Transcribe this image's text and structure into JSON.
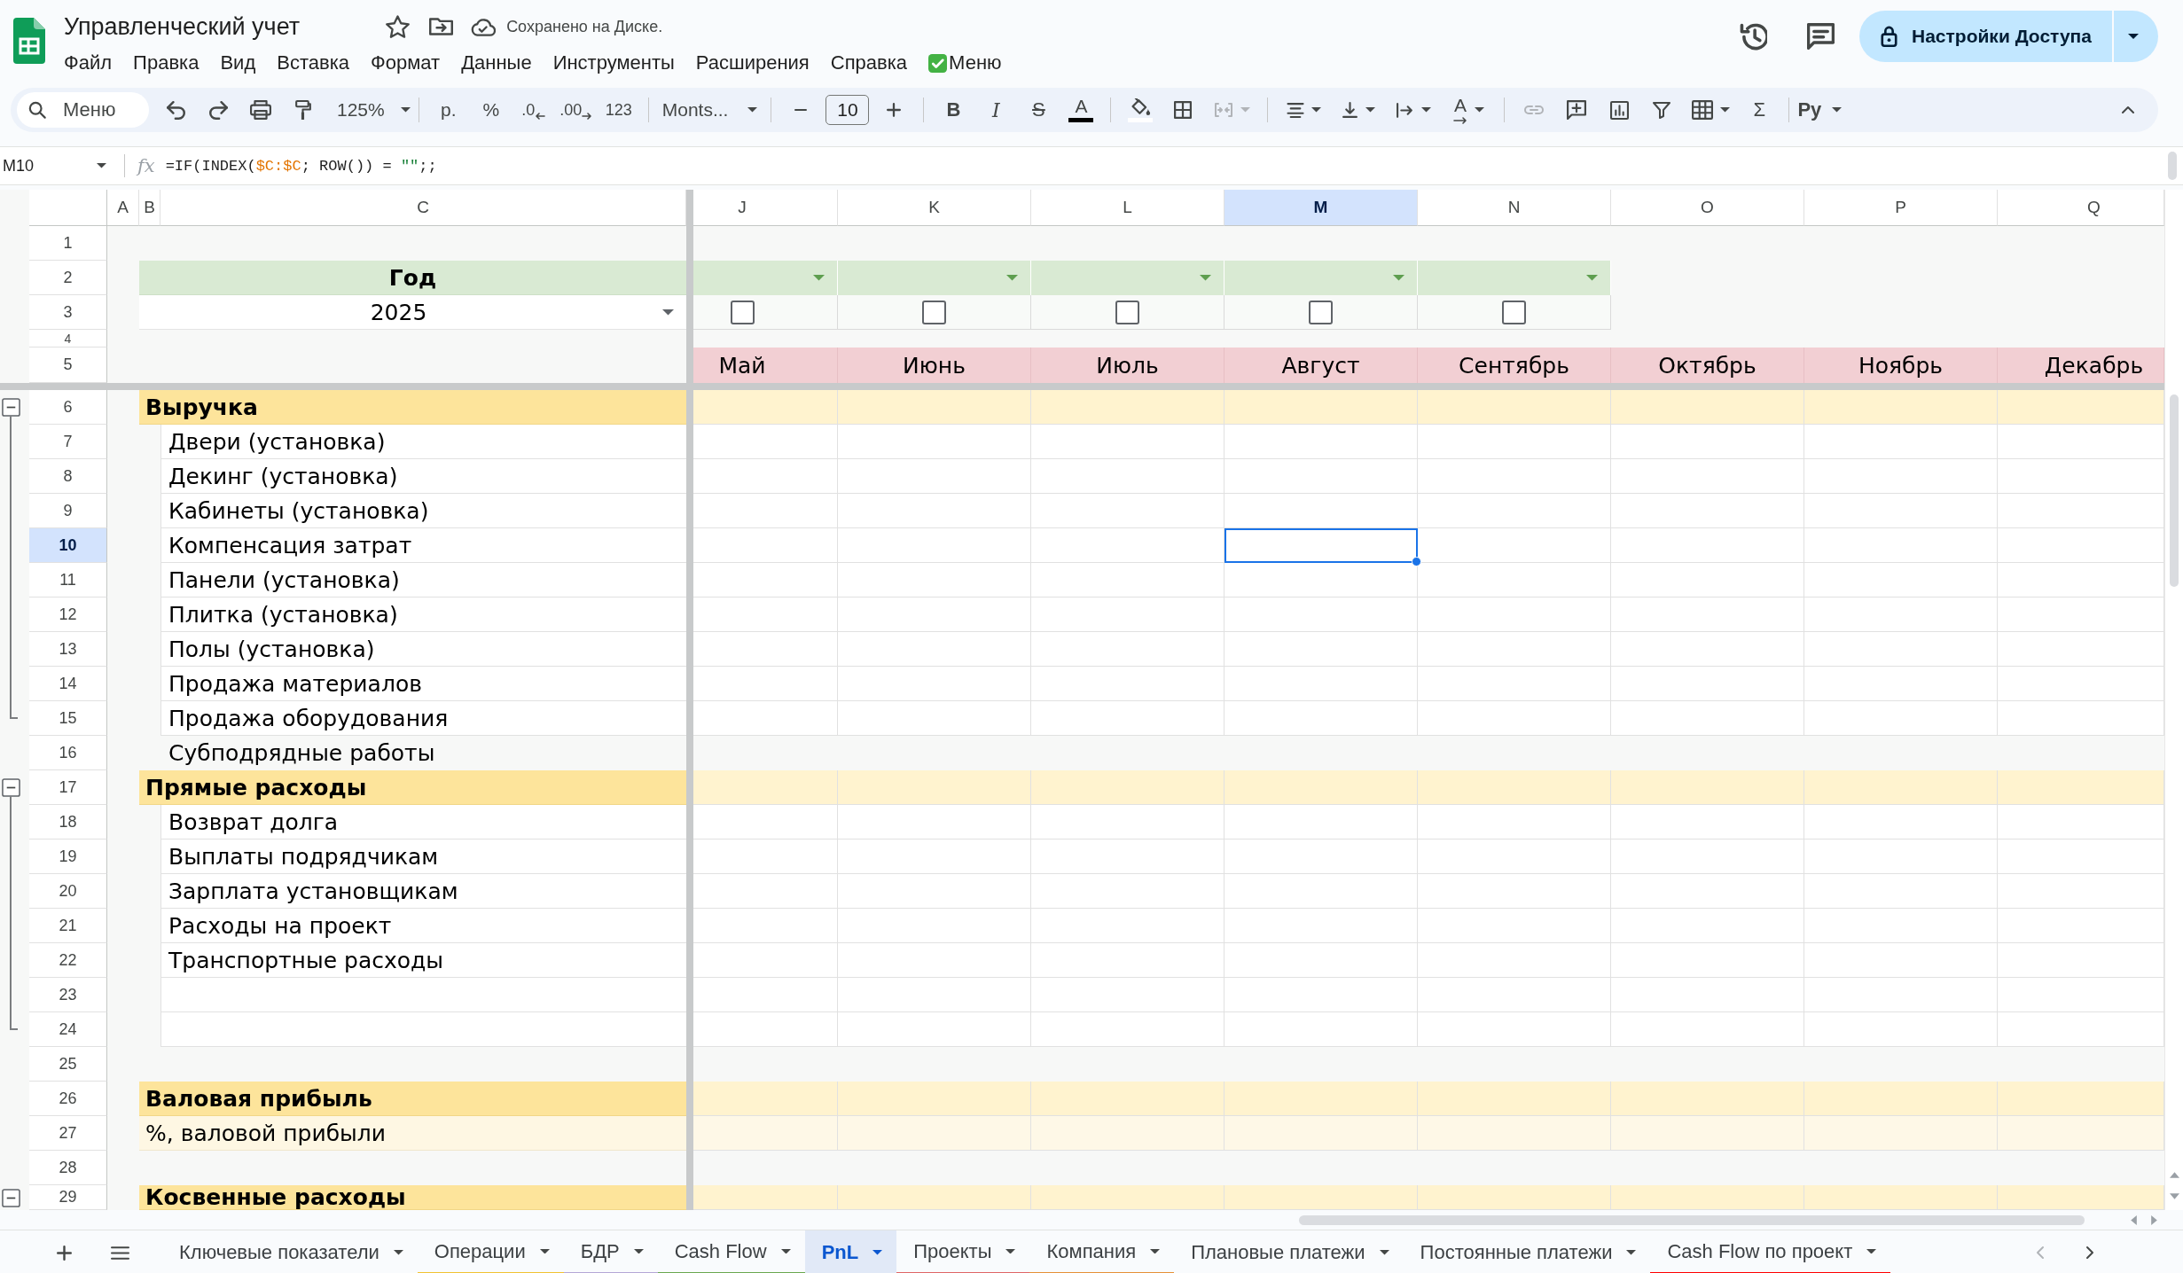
{
  "document": {
    "title": "Управленческий учет",
    "starred": false,
    "save_status": "Сохранено на Диске."
  },
  "share_button": {
    "label": "Настройки Доступа"
  },
  "menu": [
    {
      "label": "Файл",
      "kind": "menu"
    },
    {
      "label": "Правка",
      "kind": "menu"
    },
    {
      "label": "Вид",
      "kind": "menu"
    },
    {
      "label": "Вставка",
      "kind": "menu"
    },
    {
      "label": "Формат",
      "kind": "menu"
    },
    {
      "label": "Данные",
      "kind": "menu"
    },
    {
      "label": "Инструменты",
      "kind": "menu"
    },
    {
      "label": "Расширения",
      "kind": "menu"
    },
    {
      "label": "Справка",
      "kind": "menu"
    },
    {
      "label": "Меню",
      "kind": "addon"
    }
  ],
  "toolbar": {
    "search": {
      "placeholder": "Меню"
    },
    "zoom": "125%",
    "currency": "р.",
    "percent": "%",
    "decimals_less": ".0",
    "decimals_more": ".00",
    "number_format": "123",
    "font": "Monts...",
    "font_size": "10",
    "text_styles": [
      {
        "label": "B",
        "kind": "bold"
      },
      {
        "label": "I",
        "kind": "italic"
      },
      {
        "label": "S",
        "kind": "strike"
      },
      {
        "label": "A",
        "kind": "color"
      }
    ],
    "merge_disabled": true,
    "text_rotation": "A",
    "link_disabled": true,
    "functions": "Σ",
    "input_tools": "Ру"
  },
  "formula_bar": {
    "cell": "M10",
    "fx": "fx",
    "formula": [
      {
        "text": "=IF(INDEX(",
        "kind": "code"
      },
      {
        "text": "$C:$C",
        "kind": "range"
      },
      {
        "text": "; ROW()) = ",
        "kind": "code"
      },
      {
        "text": "\"\"",
        "kind": "string"
      },
      {
        "text": ";;",
        "kind": "code"
      }
    ]
  },
  "columns": [
    {
      "label": "A",
      "selected": false
    },
    {
      "label": "B",
      "selected": false
    },
    {
      "label": "C",
      "selected": false
    },
    {
      "label": "J",
      "selected": false
    },
    {
      "label": "K",
      "selected": false
    },
    {
      "label": "L",
      "selected": false
    },
    {
      "label": "M",
      "selected": true
    },
    {
      "label": "N",
      "selected": false
    },
    {
      "label": "O",
      "selected": false
    },
    {
      "label": "P",
      "selected": false
    },
    {
      "label": "Q",
      "selected": false
    }
  ],
  "top_rows": [
    {
      "number": "1",
      "selected": false
    },
    {
      "number": "2",
      "selected": false
    },
    {
      "number": "3",
      "selected": false
    },
    {
      "number": "4",
      "selected": false
    },
    {
      "number": "5",
      "selected": false
    }
  ],
  "year_filter": {
    "label": "Год",
    "value": "2025"
  },
  "period_filters": [
    {
      "checked": false
    },
    {
      "checked": false
    },
    {
      "checked": false
    },
    {
      "checked": false
    },
    {
      "checked": false
    }
  ],
  "months": [
    "Май",
    "Июнь",
    "Июль",
    "Август",
    "Сентябрь",
    "Октябрь",
    "Ноябрь",
    "Декабрь"
  ],
  "rows": [
    {
      "number": "6",
      "selected": false,
      "kind": "section",
      "label": "Выручка",
      "expanded": true,
      "children": [
        {
          "number": "7",
          "selected": false,
          "kind": "item",
          "label": "Двери (установка)"
        },
        {
          "number": "8",
          "selected": false,
          "kind": "item",
          "label": "Декинг (установка)"
        },
        {
          "number": "9",
          "selected": false,
          "kind": "item",
          "label": "Кабинеты (установка)"
        },
        {
          "number": "10",
          "selected": true,
          "kind": "item",
          "label": "Компенсация затрат"
        },
        {
          "number": "11",
          "selected": false,
          "kind": "item",
          "label": "Панели (установка)"
        },
        {
          "number": "12",
          "selected": false,
          "kind": "item",
          "label": "Плитка (установка)"
        },
        {
          "number": "13",
          "selected": false,
          "kind": "item",
          "label": "Полы (установка)"
        },
        {
          "number": "14",
          "selected": false,
          "kind": "item",
          "label": "Продажа материалов"
        },
        {
          "number": "15",
          "selected": false,
          "kind": "item",
          "label": "Продажа оборудования"
        }
      ]
    },
    {
      "number": "16",
      "selected": false,
      "kind": "plain",
      "label": "Субподрядные работы"
    },
    {
      "number": "17",
      "selected": false,
      "kind": "section",
      "label": "Прямые расходы",
      "expanded": true,
      "children": [
        {
          "number": "18",
          "selected": false,
          "kind": "item",
          "label": "Возврат долга"
        },
        {
          "number": "19",
          "selected": false,
          "kind": "item",
          "label": "Выплаты подрядчикам"
        },
        {
          "number": "20",
          "selected": false,
          "kind": "item",
          "label": "Зарплата установщикам"
        },
        {
          "number": "21",
          "selected": false,
          "kind": "item",
          "label": "Расходы на проект"
        },
        {
          "number": "22",
          "selected": false,
          "kind": "item",
          "label": "Транспортные расходы"
        },
        {
          "number": "23",
          "selected": false,
          "kind": "item"
        },
        {
          "number": "24",
          "selected": false,
          "kind": "item"
        }
      ]
    },
    {
      "number": "25",
      "selected": false,
      "kind": "gap"
    },
    {
      "number": "26",
      "selected": false,
      "kind": "section",
      "label": "Валовая прибыль"
    },
    {
      "number": "27",
      "selected": false,
      "kind": "percent",
      "label": "%, валовой прибыли"
    },
    {
      "number": "28",
      "selected": false,
      "kind": "gap"
    },
    {
      "number": "29",
      "selected": false,
      "kind": "section",
      "label": "Косвенные расходы",
      "expanded": true
    }
  ],
  "sheet_tabs": [
    {
      "label": "Ключевые показатели",
      "selected": false
    },
    {
      "label": "Операции",
      "selected": false,
      "color": "#f1c232"
    },
    {
      "label": "БДР",
      "selected": false,
      "color": "#b4a7d6"
    },
    {
      "label": "Cash Flow",
      "selected": false,
      "color": "#6aa84f"
    },
    {
      "label": "PnL",
      "selected": true
    },
    {
      "label": "Проекты",
      "selected": false,
      "color": "#e06666"
    },
    {
      "label": "Компания",
      "selected": false,
      "color": "#e69138"
    },
    {
      "label": "Плановые платежи",
      "selected": false
    },
    {
      "label": "Постоянные платежи",
      "selected": false
    },
    {
      "label": "Cash Flow по проект",
      "selected": false,
      "color": "#ff0000"
    }
  ],
  "tab_scroll": {
    "left_disabled": true,
    "right_disabled": false
  }
}
